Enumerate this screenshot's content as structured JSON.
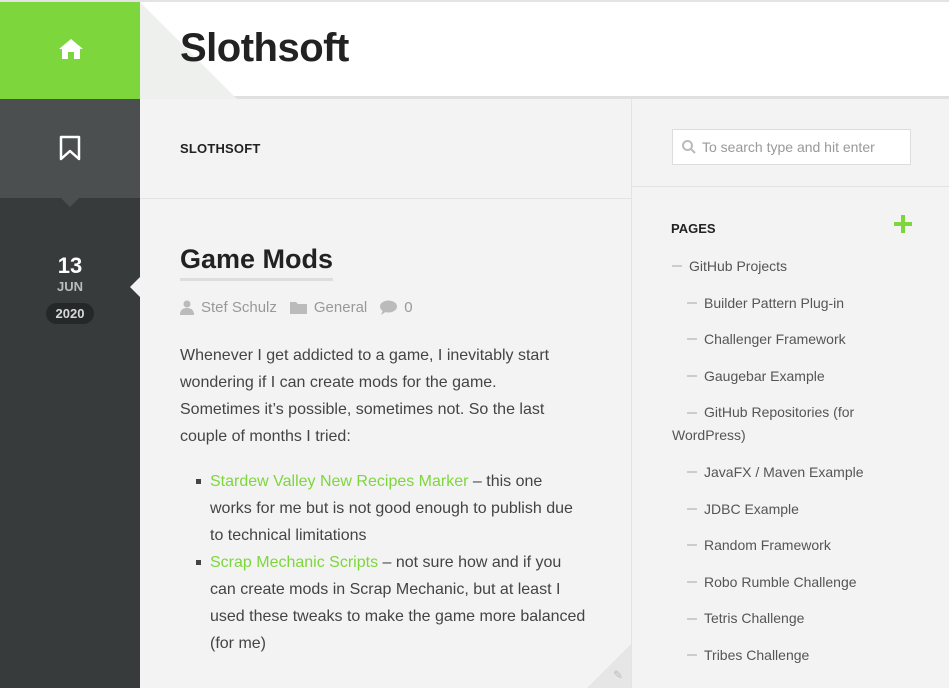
{
  "header": {
    "site_title": "Slothsoft"
  },
  "left": {
    "date": {
      "day": "13",
      "month": "JUN",
      "year": "2020"
    }
  },
  "main": {
    "breadcrumb": "SLOTHSOFT",
    "post": {
      "title": "Game Mods",
      "author": "Stef Schulz",
      "category": "General",
      "comments": "0",
      "intro": "Whenever I get addicted to a game, I inevitably start wondering if I can create mods for the game. Sometimes it’s possible, sometimes not. So the last couple of months I tried:",
      "items": [
        {
          "link": "Stardew Valley New Recipes Marker",
          "text": " – this one works for me but is not good enough to publish due to technical limitations"
        },
        {
          "link": "Scrap Mechanic Scripts",
          "text": " – not sure how and if you can create mods in Scrap Mechanic, but at least I used these tweaks to make the game more balanced (for me)"
        }
      ]
    }
  },
  "sidebar": {
    "search_placeholder": "To search type and hit enter",
    "pages_title": "PAGES",
    "pages": [
      {
        "label": "GitHub Projects",
        "level": 0
      },
      {
        "label": "Builder Pattern Plug-in",
        "level": 1
      },
      {
        "label": "Challenger Framework",
        "level": 1
      },
      {
        "label": "Gaugebar Example",
        "level": 1
      },
      {
        "label": "GitHub Repositories (for WordPress)",
        "level": 1
      },
      {
        "label": "JavaFX / Maven Example",
        "level": 1
      },
      {
        "label": "JDBC Example",
        "level": 1
      },
      {
        "label": "Random Framework",
        "level": 1
      },
      {
        "label": "Robo Rumble Challenge",
        "level": 1
      },
      {
        "label": "Tetris Challenge",
        "level": 1
      },
      {
        "label": "Tribes Challenge",
        "level": 1
      }
    ]
  },
  "colors": {
    "accent": "#7ed63d",
    "dark": "#373b3c"
  }
}
